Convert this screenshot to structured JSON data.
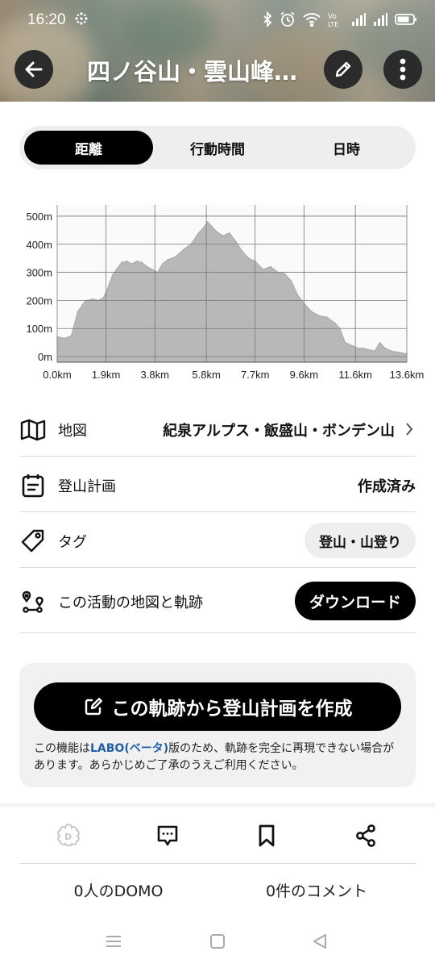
{
  "status_bar": {
    "time": "16:20",
    "battery_icon": "battery-icon",
    "signal_icons": [
      "bluetooth-icon",
      "alarm-icon",
      "wifi-icon",
      "volte-icon",
      "signal-icon",
      "signal-icon"
    ]
  },
  "header": {
    "title": "四ノ谷山・雲山峰…",
    "back_icon": "arrow-left-icon",
    "edit_icon": "pencil-icon",
    "more_icon": "more-vertical-icon"
  },
  "tabs": [
    {
      "label": "距離",
      "active": true
    },
    {
      "label": "行動時間",
      "active": false
    },
    {
      "label": "日時",
      "active": false
    }
  ],
  "chart_data": {
    "type": "area",
    "title": "",
    "xlabel": "",
    "ylabel": "",
    "x_ticks": [
      "0.0km",
      "1.9km",
      "3.8km",
      "5.8km",
      "7.7km",
      "9.6km",
      "11.6km",
      "13.6km"
    ],
    "y_ticks": [
      "500m",
      "400m",
      "300m",
      "200m",
      "100m",
      "0m"
    ],
    "xlim": [
      0,
      13.6
    ],
    "ylim": [
      -20,
      540
    ],
    "grid": true,
    "fill_color": "#b8b8b8",
    "x": [
      0,
      0.3,
      0.55,
      0.8,
      1.1,
      1.4,
      1.6,
      1.8,
      1.95,
      2.15,
      2.3,
      2.5,
      2.7,
      2.9,
      3.1,
      3.3,
      3.5,
      3.7,
      3.9,
      4.1,
      4.3,
      4.6,
      4.9,
      5.2,
      5.5,
      5.7,
      5.85,
      6.0,
      6.2,
      6.45,
      6.7,
      6.95,
      7.2,
      7.45,
      7.7,
      8.0,
      8.3,
      8.6,
      8.85,
      9.1,
      9.35,
      9.6,
      9.9,
      10.2,
      10.5,
      10.8,
      11.0,
      11.2,
      11.45,
      11.7,
      11.9,
      12.1,
      12.35,
      12.55,
      12.75,
      13.0,
      13.3,
      13.6
    ],
    "y": [
      70,
      65,
      75,
      160,
      200,
      205,
      200,
      210,
      240,
      290,
      310,
      335,
      340,
      330,
      340,
      335,
      320,
      310,
      300,
      330,
      345,
      355,
      380,
      400,
      440,
      460,
      480,
      465,
      445,
      430,
      440,
      410,
      375,
      350,
      340,
      310,
      320,
      300,
      295,
      270,
      220,
      190,
      160,
      145,
      140,
      120,
      100,
      50,
      40,
      30,
      30,
      25,
      20,
      50,
      30,
      20,
      15,
      10
    ]
  },
  "details": {
    "map": {
      "label": "地図",
      "value": "紀泉アルプス・飯盛山・ボンデン山",
      "icon": "map-icon",
      "chevron_icon": "chevron-right-icon"
    },
    "plan": {
      "label": "登山計画",
      "value": "作成済み",
      "icon": "calendar-icon"
    },
    "tag": {
      "label": "タグ",
      "value": "登山・山登り",
      "icon": "tag-icon"
    },
    "track": {
      "label": "この活動の地図と軌跡",
      "button": "ダウンロード",
      "icon": "route-icon"
    }
  },
  "plan_card": {
    "button_label": "この軌跡から登山計画を作成",
    "button_icon": "edit-square-icon",
    "note_prefix": "この機能は",
    "note_labo": "LABO(ベータ)",
    "note_suffix": "版のため、軌跡を完全に再現できない場合があります。あらかじめご了承のうえご利用ください。"
  },
  "bottom_actions": {
    "icons": [
      "domo-icon",
      "comment-icon",
      "bookmark-icon",
      "share-icon"
    ],
    "domo_count": "0人のDOMO",
    "comment_count": "0件のコメント"
  },
  "nav_bar": {
    "icons": [
      "menu-icon",
      "home-icon",
      "back-icon"
    ]
  }
}
